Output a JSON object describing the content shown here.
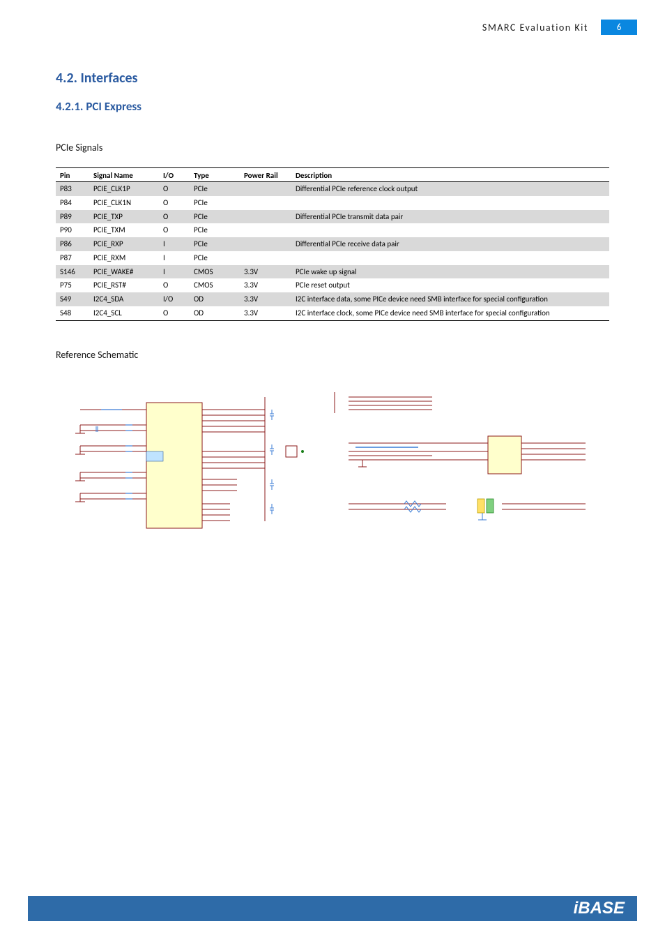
{
  "header": {
    "doc_title": "SMARC  Evaluation  Kit",
    "page_number": "6"
  },
  "sections": {
    "h2": "4.2.  Interfaces",
    "h3": "4.2.1.  PCI Express",
    "signals_heading": "PCIe Signals",
    "ref_heading": "Reference Schematic"
  },
  "table": {
    "headers": [
      "Pin",
      "Signal Name",
      "I/O",
      "Type",
      "Power Rail",
      "Description"
    ],
    "rows": [
      {
        "pin": "P83",
        "signal": "PCIE_CLK1P",
        "io": "O",
        "type": "PCIe",
        "rail": "",
        "desc": "Differential PCIe reference clock output"
      },
      {
        "pin": "P84",
        "signal": "PCIE_CLK1N",
        "io": "O",
        "type": "PCIe",
        "rail": "",
        "desc": ""
      },
      {
        "pin": "P89",
        "signal": "PCIE_TXP",
        "io": "O",
        "type": "PCIe",
        "rail": "",
        "desc": "Differential PCIe transmit data pair"
      },
      {
        "pin": "P90",
        "signal": "PCIE_TXM",
        "io": "O",
        "type": "PCIe",
        "rail": "",
        "desc": ""
      },
      {
        "pin": "P86",
        "signal": "PCIE_RXP",
        "io": "I",
        "type": "PCIe",
        "rail": "",
        "desc": "Differential PCIe receive data pair"
      },
      {
        "pin": "P87",
        "signal": "PCIE_RXM",
        "io": "I",
        "type": "PCIe",
        "rail": "",
        "desc": ""
      },
      {
        "pin": "S146",
        "signal": "PCIE_WAKE#",
        "io": "I",
        "type": "CMOS",
        "rail": "3.3V",
        "desc": "PCIe wake up signal"
      },
      {
        "pin": "P75",
        "signal": "PCIE_RST#",
        "io": "O",
        "type": "CMOS",
        "rail": "3.3V",
        "desc": "PCIe reset output"
      },
      {
        "pin": "S49",
        "signal": "I2C4_SDA",
        "io": "I/O",
        "type": "OD",
        "rail": "3.3V",
        "desc": "I2C interface data, some PICe device need SMB interface for special configuration"
      },
      {
        "pin": "S48",
        "signal": "I2C4_SCL",
        "io": "O",
        "type": "OD",
        "rail": "3.3V",
        "desc": "I2C interface clock, some PICe device need SMB interface for special configuration"
      }
    ]
  },
  "footer": {
    "logo_text": "iBASE"
  }
}
